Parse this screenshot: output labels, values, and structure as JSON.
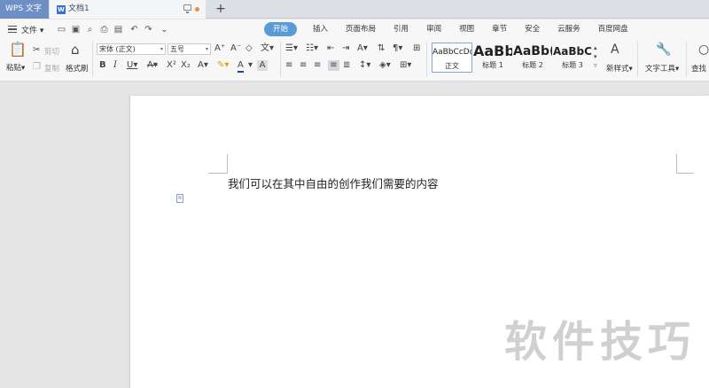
{
  "app": {
    "name": "WPS 文字"
  },
  "document_tab": {
    "title": "文档1",
    "file_icon": "W"
  },
  "menu": {
    "file_label": "文件",
    "tabs": [
      "开始",
      "插入",
      "页面布局",
      "引用",
      "审阅",
      "视图",
      "章节",
      "安全",
      "云服务",
      "百度网盘"
    ],
    "active_tab": "开始"
  },
  "ribbon": {
    "paste": "粘贴",
    "cut": "剪切",
    "copy": "复制",
    "format_painter": "格式刷",
    "font_name": "宋体 (正文)",
    "font_size": "五号",
    "styles": [
      {
        "sample": "AaBbCcDd",
        "name": "正文"
      },
      {
        "sample": "AaBb",
        "name": "标题 1"
      },
      {
        "sample": "AaBb(",
        "name": "标题 2"
      },
      {
        "sample": "AaBbC(",
        "name": "标题 3"
      }
    ],
    "new_style": "新样式",
    "text_tools": "文字工具",
    "find": "查找"
  },
  "document": {
    "body_text": "我们可以在其中自由的创作我们需要的内容",
    "watermark": "软件技巧"
  },
  "colors": {
    "accent": "#5b9bd5",
    "app_tab": "#6d8fc4"
  }
}
